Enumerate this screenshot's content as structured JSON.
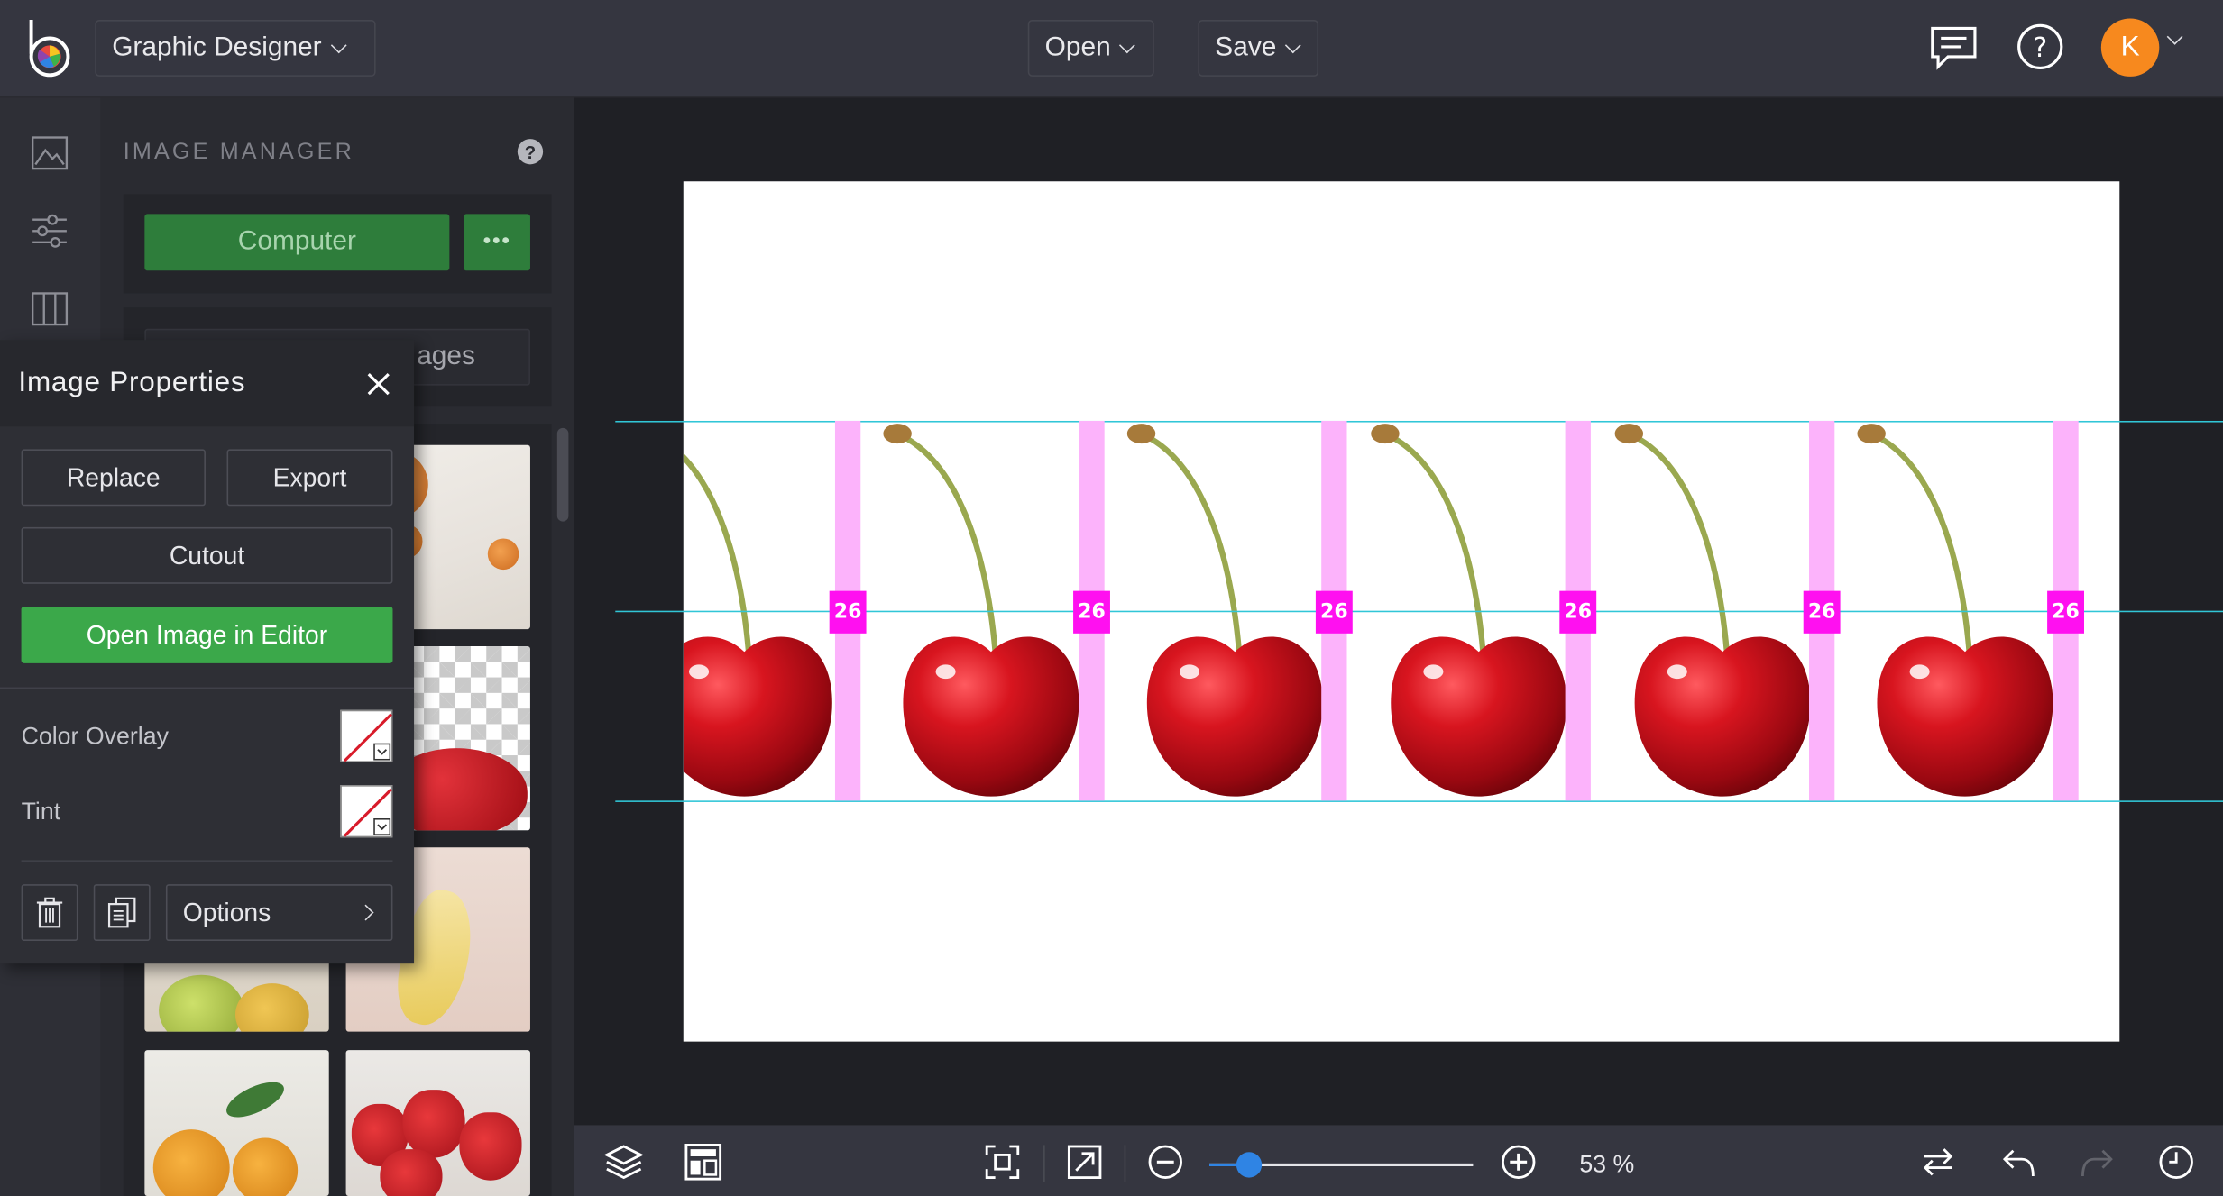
{
  "header": {
    "project_name": "Graphic Designer",
    "open_label": "Open",
    "save_label": "Save",
    "avatar_initial": "K"
  },
  "image_manager": {
    "title": "IMAGE MANAGER",
    "computer_label": "Computer",
    "more_label": "•••",
    "search_placeholder_partial": "ages"
  },
  "image_properties": {
    "title": "Image Properties",
    "replace_label": "Replace",
    "export_label": "Export",
    "cutout_label": "Cutout",
    "open_editor_label": "Open Image in Editor",
    "color_overlay_label": "Color Overlay",
    "tint_label": "Tint",
    "options_label": "Options"
  },
  "canvas": {
    "spacing_labels": [
      "26",
      "26",
      "26",
      "26",
      "26",
      "26"
    ]
  },
  "bottom": {
    "zoom_percent": 53,
    "zoom_label": "53 %"
  },
  "colors": {
    "accent_green": "#3ba84a",
    "computer_green": "#2e7d3b",
    "avatar_orange": "#f7891e",
    "guide_cyan": "#31c6d7",
    "spacing_magenta": "#ff10f0",
    "slider_blue": "#2f84e4"
  }
}
